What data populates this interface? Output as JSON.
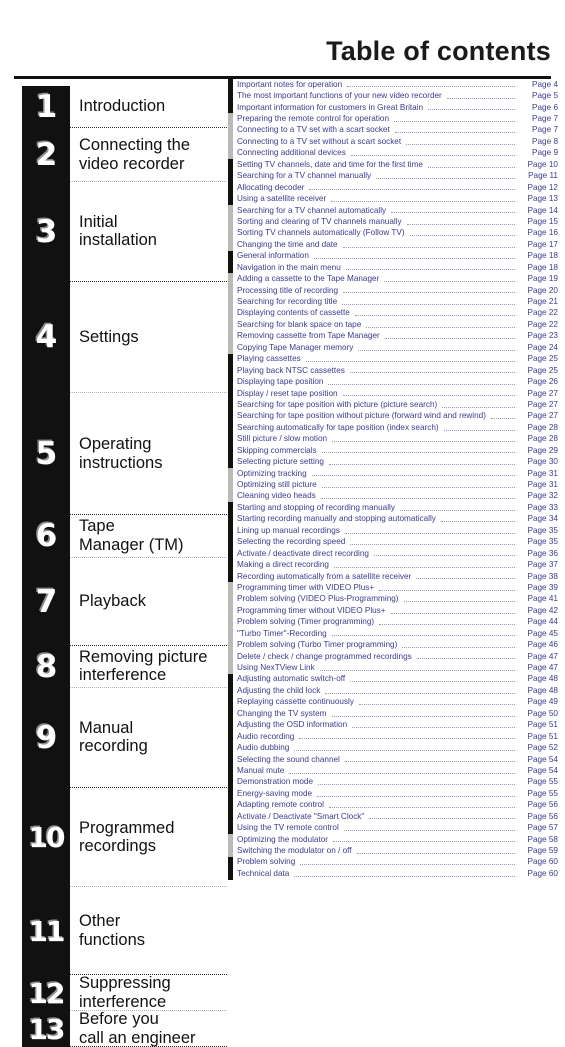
{
  "page": {
    "title": "Table of contents"
  },
  "chapters": [
    {
      "number": "1",
      "lines": [
        "Introduction"
      ]
    },
    {
      "number": "2",
      "lines": [
        "Connecting the",
        "video recorder"
      ]
    },
    {
      "number": "3",
      "lines": [
        "Initial",
        "installation"
      ]
    },
    {
      "number": "4",
      "lines": [
        "Settings"
      ]
    },
    {
      "number": "5",
      "lines": [
        "Operating",
        "instructions"
      ]
    },
    {
      "number": "6",
      "lines": [
        "Tape",
        "Manager (TM)"
      ]
    },
    {
      "number": "7",
      "lines": [
        "Playback"
      ]
    },
    {
      "number": "8",
      "lines": [
        "Removing picture",
        "interference"
      ]
    },
    {
      "number": "9",
      "lines": [
        "Manual",
        "recording"
      ]
    },
    {
      "number": "10",
      "lines": [
        "Programmed",
        "recordings"
      ]
    },
    {
      "number": "11",
      "lines": [
        "Other",
        "functions"
      ]
    },
    {
      "number": "12",
      "lines": [
        "Suppressing",
        "interference"
      ]
    },
    {
      "number": "13",
      "lines": [
        "Before you",
        "call an engineer"
      ]
    }
  ],
  "toc": [
    {
      "marker": "dark",
      "title": "Important notes for operation",
      "page": "Page 4"
    },
    {
      "marker": "dark",
      "title": "The most important functions of your new video recorder",
      "page": "Page 5"
    },
    {
      "marker": "dark",
      "title": "Important information for customers in Great Britain",
      "page": "Page 6"
    },
    {
      "marker": "gray",
      "title": "Preparing the remote control for operation",
      "page": "Page 7"
    },
    {
      "marker": "gray",
      "title": "Connecting to a TV set with a scart socket",
      "page": "Page 7"
    },
    {
      "marker": "gray",
      "title": "Connecting to a TV set without a scart socket",
      "page": "Page 8"
    },
    {
      "marker": "gray",
      "title": "Connecting additional devices",
      "page": "Page 9"
    },
    {
      "marker": "dark",
      "title": "Setting TV channels, date and time for the first time",
      "page": "Page 10"
    },
    {
      "marker": "dark",
      "title": "Searching for a TV channel manually",
      "page": "Page 11"
    },
    {
      "marker": "dark",
      "title": "Allocating decoder",
      "page": "Page 12"
    },
    {
      "marker": "dark",
      "title": "Using a satellite receiver",
      "page": "Page 13"
    },
    {
      "marker": "gray",
      "title": "Searching for a TV channel automatically",
      "page": "Page 14"
    },
    {
      "marker": "gray",
      "title": "Sorting and clearing of TV channels manually",
      "page": "Page 15"
    },
    {
      "marker": "gray",
      "title": "Sorting TV channels automatically (Follow TV)",
      "page": "Page 16"
    },
    {
      "marker": "gray",
      "title": "Changing the time and date",
      "page": "Page 17"
    },
    {
      "marker": "dark",
      "title": "General information",
      "page": "Page 18"
    },
    {
      "marker": "dark",
      "title": "Navigation in the main menu",
      "page": "Page 18"
    },
    {
      "marker": "gray",
      "title": "Adding a cassette to the Tape Manager",
      "page": "Page 19"
    },
    {
      "marker": "gray",
      "title": "Processing title of recording",
      "page": "Page 20"
    },
    {
      "marker": "gray",
      "title": "Searching for recording title",
      "page": "Page 21"
    },
    {
      "marker": "gray",
      "title": "Displaying contents of cassette",
      "page": "Page 22"
    },
    {
      "marker": "gray",
      "title": "Searching for blank space on tape",
      "page": "Page 22"
    },
    {
      "marker": "gray",
      "title": "Removing cassette from Tape Manager",
      "page": "Page 23"
    },
    {
      "marker": "gray",
      "title": "Copying Tape Manager memory",
      "page": "Page 24"
    },
    {
      "marker": "dark",
      "title": "Playing cassettes",
      "page": "Page 25"
    },
    {
      "marker": "dark",
      "title": "Playing back NTSC cassettes",
      "page": "Page 25"
    },
    {
      "marker": "dark",
      "title": "Displaying tape position",
      "page": "Page 26"
    },
    {
      "marker": "dark",
      "title": "Display / reset tape position",
      "page": "Page 27"
    },
    {
      "marker": "dark",
      "title": "Searching for tape position with picture (picture search)",
      "page": "Page 27"
    },
    {
      "marker": "dark",
      "title": "Searching for tape position without picture (forward wind and rewind)",
      "page": "Page 27"
    },
    {
      "marker": "dark",
      "title": "Searching automatically for tape position (index search)",
      "page": "Page 28"
    },
    {
      "marker": "dark",
      "title": "Still picture / slow motion",
      "page": "Page 28"
    },
    {
      "marker": "dark",
      "title": "Skipping commercials",
      "page": "Page 29"
    },
    {
      "marker": "dark",
      "title": "Selecting picture setting",
      "page": "Page 30"
    },
    {
      "marker": "gray",
      "title": "Optimizing tracking",
      "page": "Page 31"
    },
    {
      "marker": "gray",
      "title": "Optimizing still picture",
      "page": "Page 31"
    },
    {
      "marker": "gray",
      "title": "Cleaning video heads",
      "page": "Page 32"
    },
    {
      "marker": "dark",
      "title": "Starting and stopping of recording manually",
      "page": "Page 33"
    },
    {
      "marker": "dark",
      "title": "Starting recording manually and stopping automatically",
      "page": "Page 34"
    },
    {
      "marker": "dark",
      "title": "Lining up manual recordings",
      "page": "Page 35"
    },
    {
      "marker": "dark",
      "title": "Selecting the recording speed",
      "page": "Page 35"
    },
    {
      "marker": "dark",
      "title": "Activate / deactivate direct recording",
      "page": "Page 36"
    },
    {
      "marker": "dark",
      "title": "Making a direct recording",
      "page": "Page 37"
    },
    {
      "marker": "dark",
      "title": "Recording automatically from a satellite receiver",
      "page": "Page 38"
    },
    {
      "marker": "gray",
      "title": "Programming timer with VIDEO Plus+",
      "page": "Page 39"
    },
    {
      "marker": "gray",
      "title": "Problem solving (VIDEO Plus-Programming)",
      "page": "Page 41"
    },
    {
      "marker": "gray",
      "title": "Programming timer without VIDEO Plus+",
      "page": "Page 42"
    },
    {
      "marker": "gray",
      "title": "Problem solving (Timer programming)",
      "page": "Page 44"
    },
    {
      "marker": "gray",
      "title": "\"Turbo Timer\"-Recording",
      "page": "Page 45"
    },
    {
      "marker": "gray",
      "title": "Problem solving (Turbo Timer programming)",
      "page": "Page 46"
    },
    {
      "marker": "gray",
      "title": "Delete / check / change programmed recordings",
      "page": "Page 47"
    },
    {
      "marker": "gray",
      "title": "Using NexTView Link",
      "page": "Page 47"
    },
    {
      "marker": "dark",
      "title": "Adjusting automatic switch-off",
      "page": "Page 48"
    },
    {
      "marker": "dark",
      "title": "Adjusting the child lock",
      "page": "Page 48"
    },
    {
      "marker": "dark",
      "title": "Replaying cassette continuously",
      "page": "Page 49"
    },
    {
      "marker": "dark",
      "title": "Changing the TV system",
      "page": "Page 50"
    },
    {
      "marker": "dark",
      "title": "Adjusting the OSD information",
      "page": "Page 51"
    },
    {
      "marker": "dark",
      "title": "Audio recording",
      "page": "Page 51"
    },
    {
      "marker": "dark",
      "title": "Audio dubbing",
      "page": "Page 52"
    },
    {
      "marker": "dark",
      "title": "Selecting the sound channel",
      "page": "Page 54"
    },
    {
      "marker": "dark",
      "title": "Manual mute",
      "page": "Page 54"
    },
    {
      "marker": "dark",
      "title": "Demonstration mode",
      "page": "Page 55"
    },
    {
      "marker": "dark",
      "title": "Energy-saving mode",
      "page": "Page 55"
    },
    {
      "marker": "dark",
      "title": "Adapting remote control",
      "page": "Page 56"
    },
    {
      "marker": "dark",
      "title": "Activate / Deactivate \"Smart Clock\"",
      "page": "Page 56"
    },
    {
      "marker": "dark",
      "title": "Using the TV remote control",
      "page": "Page 57"
    },
    {
      "marker": "gray",
      "title": "Optimizing the modulator",
      "page": "Page 58"
    },
    {
      "marker": "gray",
      "title": "Switching the modulator on / off",
      "page": "Page 59"
    },
    {
      "marker": "dark",
      "title": "Problem solving",
      "page": "Page 60"
    },
    {
      "marker": "dark",
      "title": "Technical data",
      "page": "Page 60"
    }
  ]
}
